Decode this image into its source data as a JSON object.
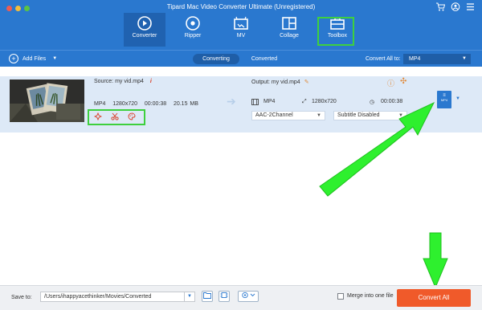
{
  "window": {
    "title": "Tipard Mac Video Converter Ultimate (Unregistered)",
    "controls": [
      "close",
      "minimize",
      "maximize"
    ],
    "right_icons": [
      "cart-icon",
      "user-icon",
      "menu-icon"
    ]
  },
  "nav": {
    "tabs": [
      {
        "label": "Converter",
        "icon": "converter-icon",
        "active": true
      },
      {
        "label": "Ripper",
        "icon": "ripper-icon",
        "active": false
      },
      {
        "label": "MV",
        "icon": "mv-icon",
        "active": false
      },
      {
        "label": "Collage",
        "icon": "collage-icon",
        "active": false
      },
      {
        "label": "Toolbox",
        "icon": "toolbox-icon",
        "active": false,
        "highlighted": true
      }
    ]
  },
  "subbar": {
    "add_files": "Add Files",
    "tabs": [
      "Converting",
      "Converted"
    ],
    "convert_all_to_label": "Convert All to:",
    "format": "MP4"
  },
  "file": {
    "source_label": "Source: my vid.mp4",
    "source_format": "MP4",
    "source_resolution": "1280x720",
    "source_duration": "00:00:38",
    "source_size": "20.15 MB",
    "output_label": "Output: my vid.mp4",
    "output_format": "MP4",
    "output_resolution": "1280x720",
    "output_duration": "00:00:38",
    "audio_track": "AAC-2Channel",
    "subtitle": "Subtitle Disabled",
    "edit_tools": [
      "enhance-icon",
      "cut-icon",
      "palette-icon"
    ],
    "format_badge": "MP4"
  },
  "bottom": {
    "save_to_label": "Save to:",
    "save_path": "/Users/ihappyacethinker/Movies/Converted",
    "merge_label": "Merge into one file",
    "merge_checked": false,
    "convert_all_button": "Convert All"
  },
  "colors": {
    "header_blue": "#2a78cf",
    "accent_orange": "#f05a2a",
    "highlight_green": "#3ed03e",
    "row_blue": "#dde9f7"
  }
}
